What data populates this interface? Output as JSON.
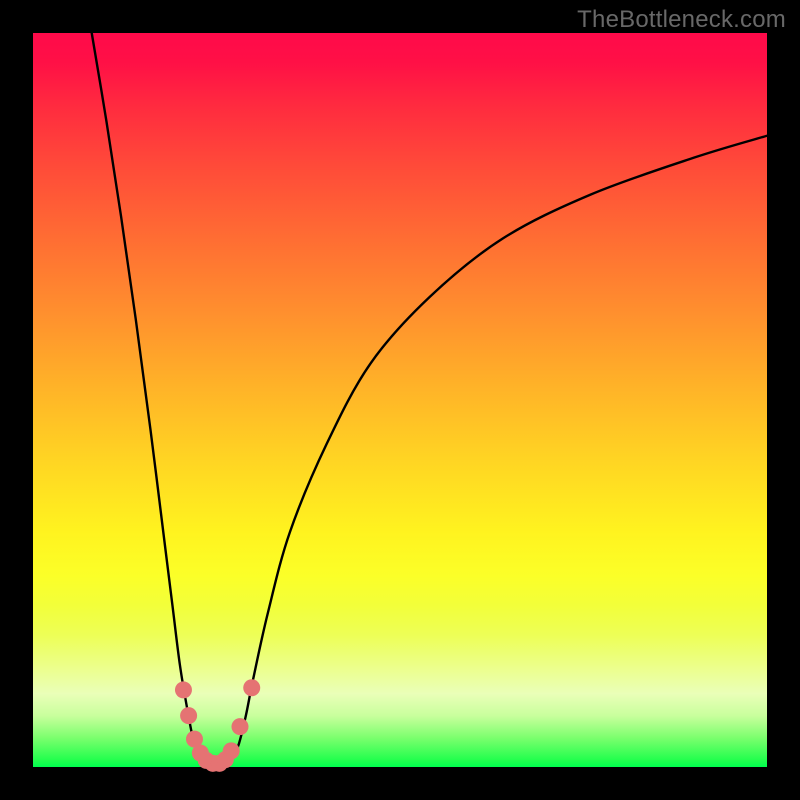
{
  "watermark": "TheBottleneck.com",
  "chart_data": {
    "type": "line",
    "title": "",
    "xlabel": "",
    "ylabel": "",
    "xlim": [
      0,
      100
    ],
    "ylim": [
      0,
      100
    ],
    "series": [
      {
        "name": "bottleneck-curve",
        "x": [
          8,
          10,
          12,
          14,
          16,
          18,
          19,
          20,
          21,
          22,
          23,
          24,
          25,
          26,
          27,
          28,
          29,
          30,
          32,
          35,
          40,
          46,
          54,
          64,
          76,
          90,
          100
        ],
        "values": [
          100,
          88,
          75,
          61,
          46,
          30,
          22,
          14,
          8,
          3,
          1,
          0,
          0,
          0,
          1,
          3,
          7,
          12,
          21,
          32,
          44,
          55,
          64,
          72,
          78,
          83,
          86
        ]
      }
    ],
    "markers": {
      "name": "highlight-dots",
      "color": "#e57373",
      "points_xy": [
        [
          20.5,
          10.5
        ],
        [
          21.2,
          7.0
        ],
        [
          22.0,
          3.8
        ],
        [
          22.8,
          1.9
        ],
        [
          23.6,
          0.9
        ],
        [
          24.5,
          0.5
        ],
        [
          25.4,
          0.5
        ],
        [
          26.2,
          1.0
        ],
        [
          27.0,
          2.2
        ],
        [
          28.2,
          5.5
        ],
        [
          29.8,
          10.8
        ]
      ]
    }
  }
}
